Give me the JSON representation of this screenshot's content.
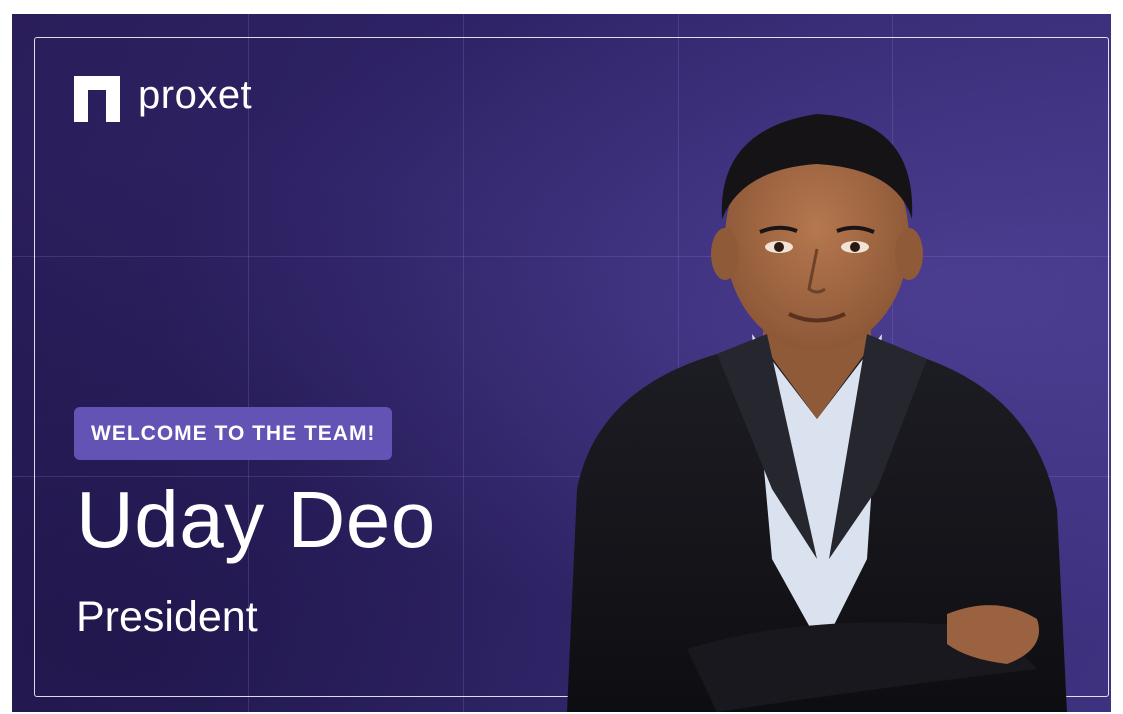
{
  "brand": {
    "name": "proxet"
  },
  "badge": {
    "label": "WELCOME TO THE TEAM!"
  },
  "person": {
    "name": "Uday Deo",
    "title": "President"
  },
  "colors": {
    "background": "#2e2366",
    "accent": "#6253b5",
    "text": "#ffffff"
  },
  "icons": {
    "logo": "proxet-logo-icon"
  }
}
